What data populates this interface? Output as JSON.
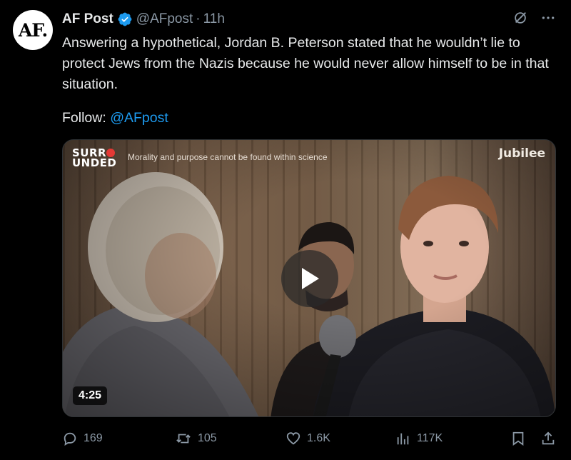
{
  "author": {
    "avatar_text": "AF.",
    "name": "AF Post",
    "handle": "@AFpost",
    "separator": "·",
    "time": "11h"
  },
  "tweet": {
    "text": "Answering a hypothetical, Jordan B. Peterson stated that he wouldn’t lie to protect Jews from the Nazis because he would never allow himself to be in that situation.",
    "follow_prefix": "Follow: ",
    "follow_handle": "@AFpost"
  },
  "video": {
    "show_logo_line1": "SURR",
    "show_logo_line2": "UNDED",
    "subtitle": "Morality and purpose cannot be found within science",
    "channel": "Jubilee",
    "duration": "4:25"
  },
  "metrics": {
    "replies": "169",
    "reposts": "105",
    "likes": "1.6K",
    "views": "117K"
  },
  "icons": {
    "verified": "verified-badge-icon",
    "grok": "grok-icon",
    "more": "more-icon",
    "reply": "reply-icon",
    "repost": "repost-icon",
    "like": "like-icon",
    "views": "views-icon",
    "bookmark": "bookmark-icon",
    "share": "share-icon"
  },
  "colors": {
    "background": "#000000",
    "text": "#e7e9ea",
    "muted": "#8b98a5",
    "link": "#1d9bf0",
    "verified": "#1d9bf0"
  }
}
